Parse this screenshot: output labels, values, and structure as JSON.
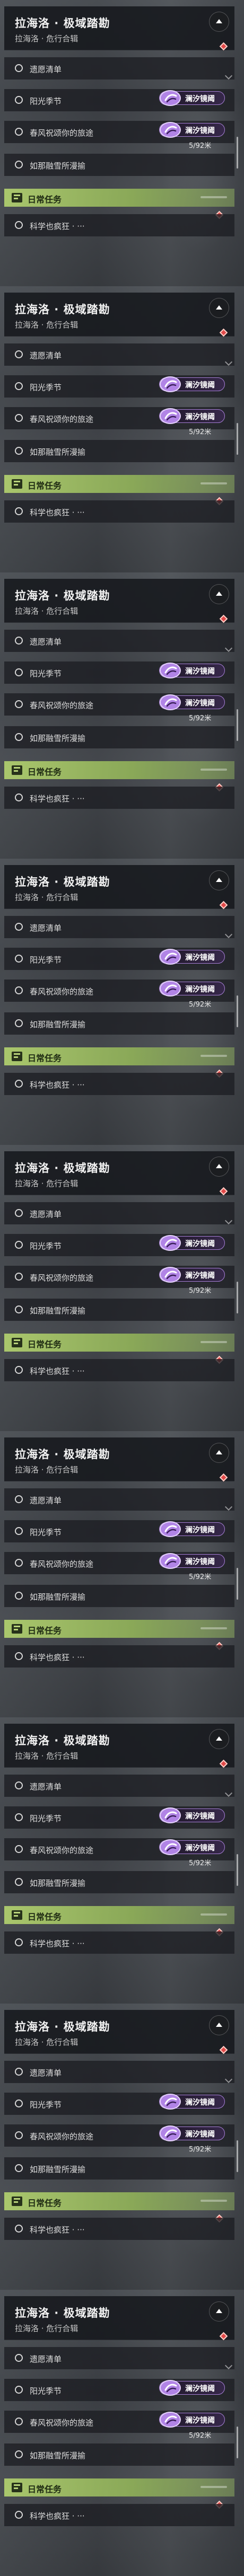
{
  "quest": {
    "title": "拉海洛 · 极域踏勘",
    "subtitle": "拉海洛 · 危行合辑",
    "items": [
      "遗愿清单",
      "阳光季节",
      "春风祝颂你的旅途",
      "如那融雪所漫揄"
    ],
    "tag_label": "澜汐镜阈",
    "distance": "5/92米",
    "daily_label": "日常任务",
    "daily_item": "科学也疯狂 · ···"
  },
  "icons": {
    "collapse": "chevron-up-icon",
    "item_status": "circle-icon",
    "tag_logo": "tide-swirl-icon",
    "daily": "task-book-icon",
    "marker": "red-diamond-icon"
  },
  "colors": {
    "header_bg": "#16181c",
    "daily_accent": "#afcd6e",
    "tag_border": "#a880d8",
    "tag_logo": "#b184e6",
    "marker": "#e24a4a"
  },
  "panel_count": 9
}
